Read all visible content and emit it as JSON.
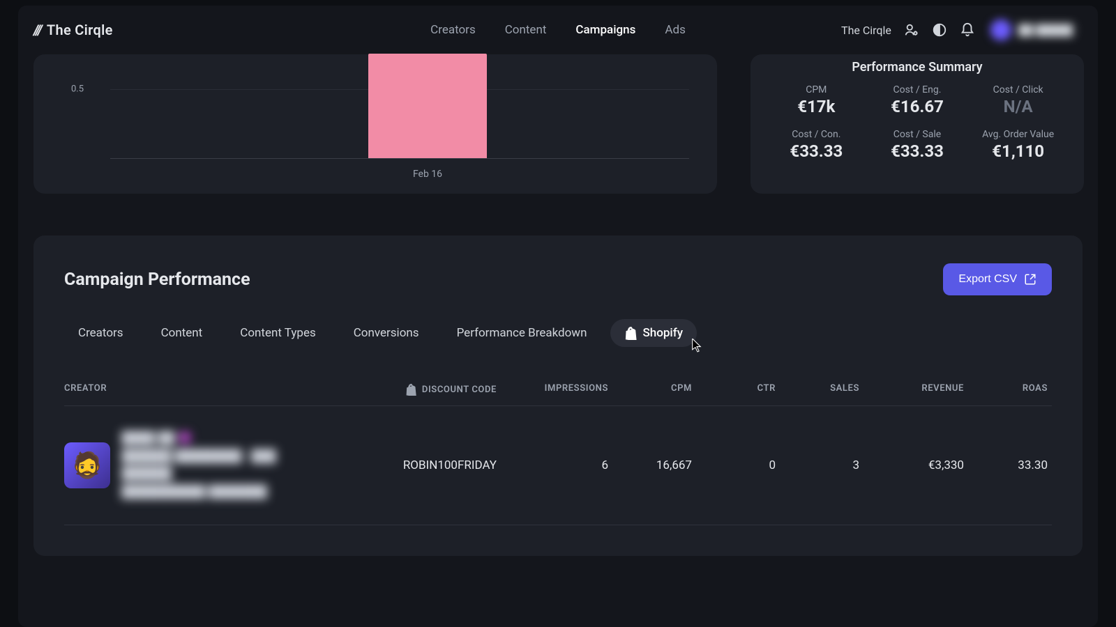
{
  "brand": "The Cirqle",
  "nav": {
    "items": [
      "Creators",
      "Content",
      "Campaigns",
      "Ads"
    ],
    "active_index": 2
  },
  "org": {
    "name": "The Cirqle"
  },
  "user": {
    "display_name": "██ █████"
  },
  "chart_data": {
    "type": "bar",
    "categories": [
      "Feb 16"
    ],
    "values": [
      1.0
    ],
    "ylim": [
      0,
      1.0
    ],
    "yticks": [
      0.5
    ],
    "xlabel": "",
    "ylabel": "",
    "title": ""
  },
  "summary": {
    "title": "Performance Summary",
    "metrics": [
      {
        "label": "CPM",
        "value": "€17k"
      },
      {
        "label": "Cost / Eng.",
        "value": "€16.67"
      },
      {
        "label": "Cost / Click",
        "value": "N/A",
        "dim": true
      },
      {
        "label": "Cost / Con.",
        "value": "€33.33"
      },
      {
        "label": "Cost / Sale",
        "value": "€33.33"
      },
      {
        "label": "Avg. Order Value",
        "value": "€1,110"
      }
    ]
  },
  "performance": {
    "title": "Campaign Performance",
    "export_label": "Export CSV",
    "tabs": [
      {
        "label": "Creators"
      },
      {
        "label": "Content"
      },
      {
        "label": "Content Types"
      },
      {
        "label": "Conversions"
      },
      {
        "label": "Performance Breakdown"
      },
      {
        "label": "Shopify",
        "icon": "shopify",
        "active": true
      }
    ],
    "columns": {
      "creator": "CREATOR",
      "discount_code": "DISCOUNT CODE",
      "impressions": "IMPRESSIONS",
      "cpm": "CPM",
      "ctr": "CTR",
      "sales": "SALES",
      "revenue": "REVENUE",
      "roas": "ROAS"
    },
    "rows": [
      {
        "creator_name": "████ ██ 🟣",
        "creator_sub1": "██████ ████████ · ███",
        "creator_sub2": "██████",
        "creator_sub3": "██████████  ███████",
        "discount_code": "ROBIN100FRIDAY",
        "impressions": "6",
        "cpm": "16,667",
        "ctr": "0",
        "sales": "3",
        "revenue": "€3,330",
        "roas": "33.30"
      }
    ]
  },
  "colors": {
    "accent": "#5959e6",
    "bar": "#f28ca6",
    "card": "#1d2028",
    "page": "#14161c",
    "outer": "#0d0f13"
  }
}
